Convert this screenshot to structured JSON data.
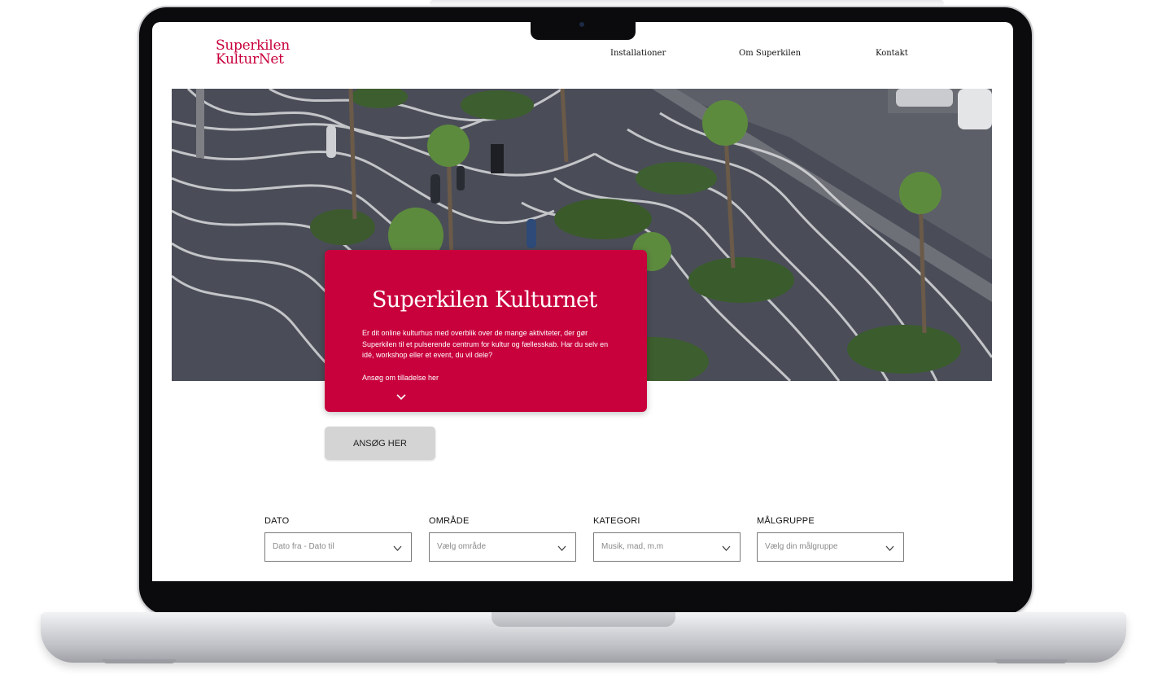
{
  "site": {
    "logo_line1": "Superkilen",
    "logo_line2": "KulturNet",
    "nav": [
      {
        "label": "Installationer"
      },
      {
        "label": "Om Superkilen"
      },
      {
        "label": "Kontakt"
      }
    ]
  },
  "hero": {
    "title": "Superkilen Kulturnet",
    "text": "Er dit online kulturhus med overblik over de mange aktiviteter, der gør Superkilen til et pulserende centrum for kultur og fællesskab. Har du selv en idé, workshop eller et event, du vil dele?",
    "link": "Ansøg om tilladelse her",
    "button": "ANSØG HER"
  },
  "filters": [
    {
      "label": "DATO",
      "placeholder": "Dato fra - Dato til"
    },
    {
      "label": "OMRÅDE",
      "placeholder": "Vælg område"
    },
    {
      "label": "KATEGORI",
      "placeholder": "Musik, mad, m.m"
    },
    {
      "label": "MÅLGRUPPE",
      "placeholder": "Vælg din målgruppe"
    }
  ],
  "colors": {
    "accent": "#c8003c",
    "button_bg": "#d4d4d4",
    "frame": "#0b0b0d"
  },
  "icons": {
    "chevron": "chevron-down-icon",
    "camera": "camera-icon"
  }
}
